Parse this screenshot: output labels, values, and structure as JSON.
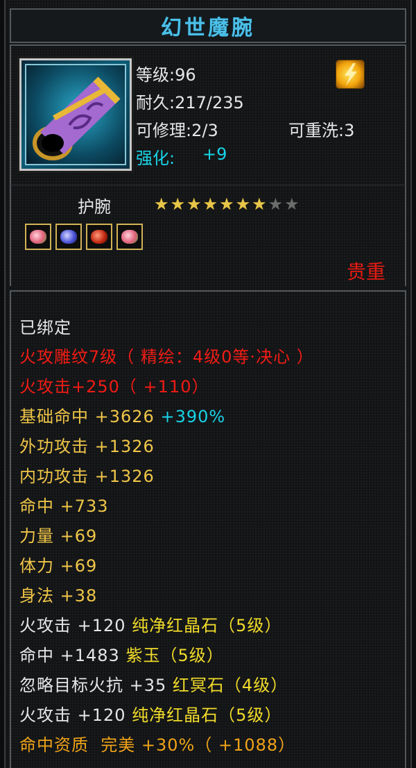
{
  "title": "幻世魔腕",
  "header": {
    "level": "等级:96",
    "durability": "耐久:217/235",
    "repair": "可修理:2/3",
    "rewash": "可重洗:3",
    "enhance_label": "强化:",
    "enhance_value": "+9"
  },
  "item_type": "护腕",
  "stars": {
    "filled": 7,
    "total": 9
  },
  "gems": [
    "pink-gem-icon",
    "blue-gem-icon",
    "red-gem-icon",
    "pink-gem-icon"
  ],
  "rarity": "贵重",
  "attributes": {
    "bound": "已绑定",
    "engrave": "火攻雕纹7级（ 精绘：4级0等·决心 ）",
    "fire_attack": "火攻击+250（ +110）",
    "base_hit_label": "基础命中 +3626",
    "base_hit_pct": "+390%",
    "ext_attack": "外功攻击 +1326",
    "int_attack": "内功攻击 +1326",
    "hit": "命中 +733",
    "strength": "力量 +69",
    "stamina": "体力 +69",
    "agility": "身法 +38",
    "gem1_label": "火攻击 +120",
    "gem1_name": "纯净红晶石（5级）",
    "gem2_label": "命中 +1483",
    "gem2_name": "紫玉（5级）",
    "gem3_label": "忽略目标火抗 +35",
    "gem3_name": "红冥石（4级）",
    "gem4_label": "火攻击 +120",
    "gem4_name": "纯净红晶石（5级）",
    "aptitude_label": "命中资质",
    "aptitude_quality": "完美",
    "aptitude_value": "+30%（ +1088）"
  },
  "colors": {
    "title": "#4cc0e8",
    "enhance": "#19d3e6",
    "rarity": "#e61a12",
    "engrave": "#f01c14",
    "base_attr": "#f0c648",
    "aptitude": "#f0a318"
  }
}
